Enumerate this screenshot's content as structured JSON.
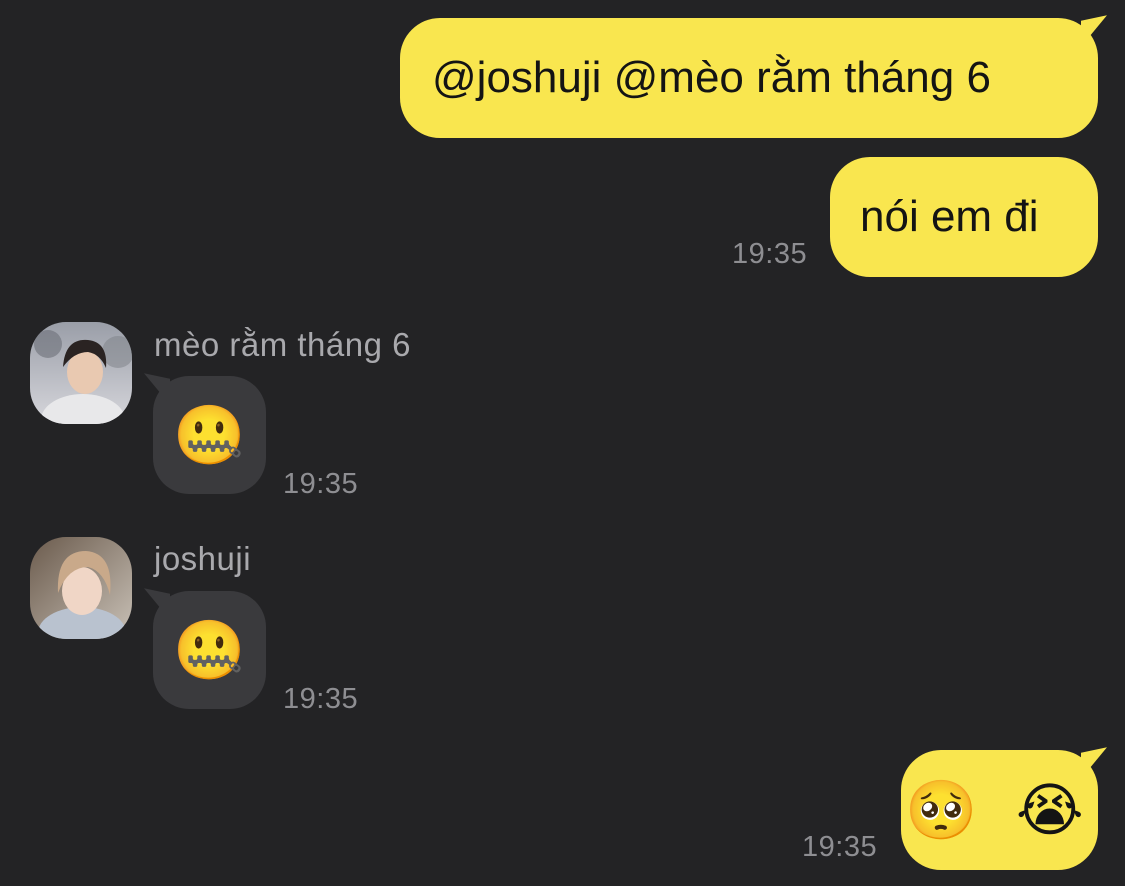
{
  "messages": [
    {
      "type": "outgoing",
      "text": "@joshuji @mèo rằm tháng 6"
    },
    {
      "type": "outgoing",
      "text": "nói em đi",
      "time": "19:35"
    },
    {
      "type": "incoming",
      "sender": "mèo rằm tháng 6",
      "emoji": "🤐",
      "time": "19:35",
      "avatar_icon": "profile-photo-icon"
    },
    {
      "type": "incoming",
      "sender": "joshuji",
      "emoji": "🤐",
      "time": "19:35",
      "avatar_icon": "profile-photo-icon"
    },
    {
      "type": "outgoing",
      "emoji": "🥺 😭",
      "time": "19:35"
    }
  ],
  "colors": {
    "background": "#232325",
    "outgoing_bubble": "#f9e64f",
    "incoming_bubble": "#3a3a3d",
    "timestamp": "#8e8e92",
    "sender_name": "#a9a9ad"
  }
}
